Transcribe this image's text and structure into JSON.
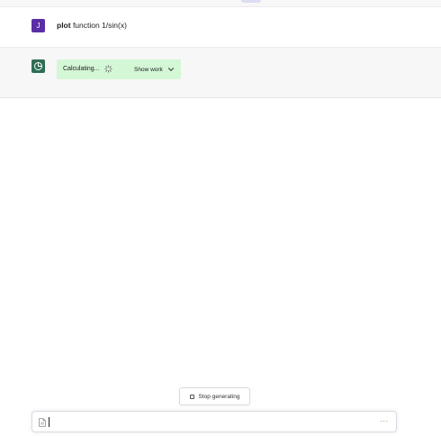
{
  "top": {
    "tab_hint": ""
  },
  "conversation": {
    "user": {
      "avatar_initial": "J",
      "message_keyword": "plot",
      "message_rest": " function 1/sin(x)"
    },
    "assistant": {
      "status_label": "Calculating...",
      "spinner_icon": "spinner-icon",
      "show_work_label": "Show work",
      "chevron_icon": "chevron-down-icon"
    }
  },
  "controls": {
    "stop_label": "Stop generating"
  },
  "composer": {
    "value": "",
    "placeholder": "",
    "more_label": "···"
  },
  "colors": {
    "user_avatar": "#5a2ea6",
    "assistant_avatar": "#2f6e55",
    "calc_box": "#d4f7d6",
    "assistant_row_bg": "#f7f7f8"
  }
}
